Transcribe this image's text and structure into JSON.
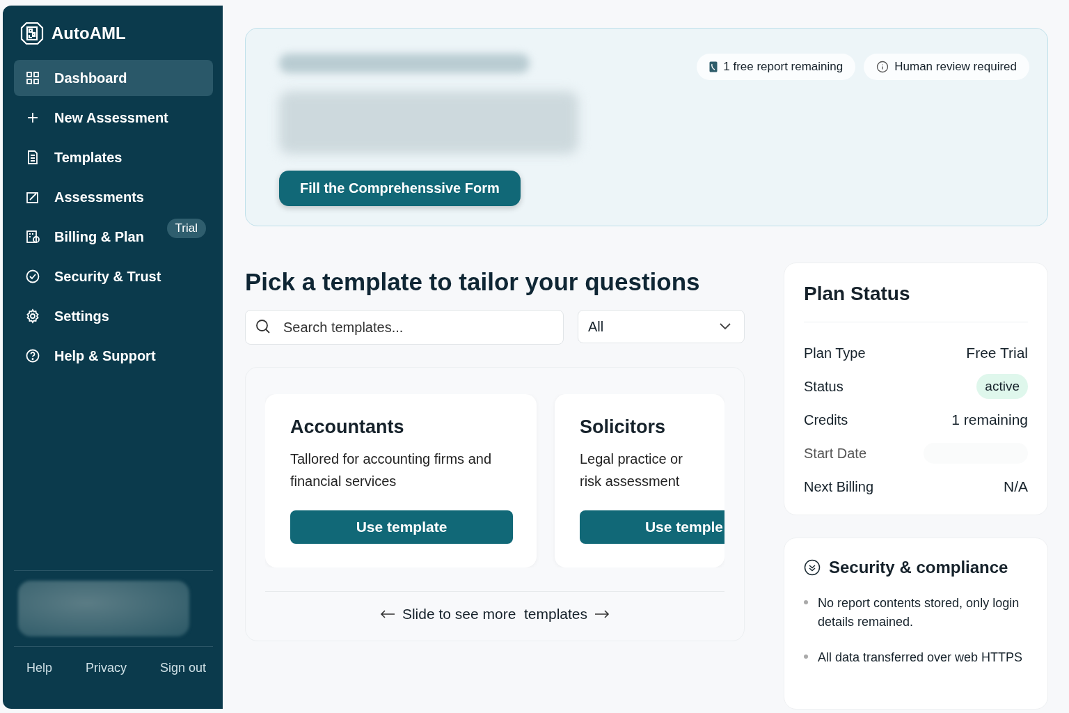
{
  "brand": {
    "name": "AutoAML"
  },
  "sidebar": {
    "items": [
      {
        "label": "Dashboard",
        "kind": "grid",
        "selected": true
      },
      {
        "label": "New Assessment",
        "kind": "plus",
        "selected": false
      },
      {
        "label": "Templates",
        "kind": "doc",
        "selected": false
      },
      {
        "label": "Assessments",
        "kind": "edit",
        "selected": false
      },
      {
        "label": "Billing & Plan",
        "kind": "billing",
        "selected": false,
        "badge": "Trial"
      },
      {
        "label": "Security & Trust",
        "kind": "check",
        "selected": false
      },
      {
        "label": "Settings",
        "kind": "gear",
        "selected": false
      },
      {
        "label": "Help & Support",
        "kind": "help",
        "selected": false
      }
    ],
    "footer_links": [
      "Help",
      "Privacy",
      "Sign out"
    ]
  },
  "hero": {
    "chips": [
      {
        "kind": "report",
        "label": "1 free report remaining"
      },
      {
        "kind": "review",
        "label": "Human review required"
      }
    ],
    "button": "Fill the Comprehenssive Form"
  },
  "templates": {
    "heading": "Pick a template to tailor your questions",
    "search": {
      "placeholder": "Search templates..."
    },
    "filter": {
      "value": "All"
    },
    "cards": [
      {
        "title": "Accountants",
        "description": "Tallored for accounting firms and financial services",
        "button": "Use template"
      },
      {
        "title": "Solicitors",
        "description": "Legal practice or risk assessment",
        "button": "Use temple"
      }
    ],
    "hint": "Slide to see more  templates"
  },
  "plan_status": {
    "title": "Plan Status",
    "rows": [
      {
        "kind": "text",
        "label": "Plan Type",
        "value": "Free Trial"
      },
      {
        "kind": "pill",
        "label": "Status",
        "value": "active"
      },
      {
        "kind": "text",
        "label": "Credits",
        "value": "1 remaining"
      },
      {
        "kind": "hidden",
        "label": "Start Date"
      },
      {
        "kind": "text",
        "label": "Next Billing",
        "value": "N/A"
      }
    ]
  },
  "security": {
    "title": "Security & compliance",
    "items": [
      "No report contents stored, only login details remained.",
      "All data transferred over web HTTPS"
    ]
  }
}
